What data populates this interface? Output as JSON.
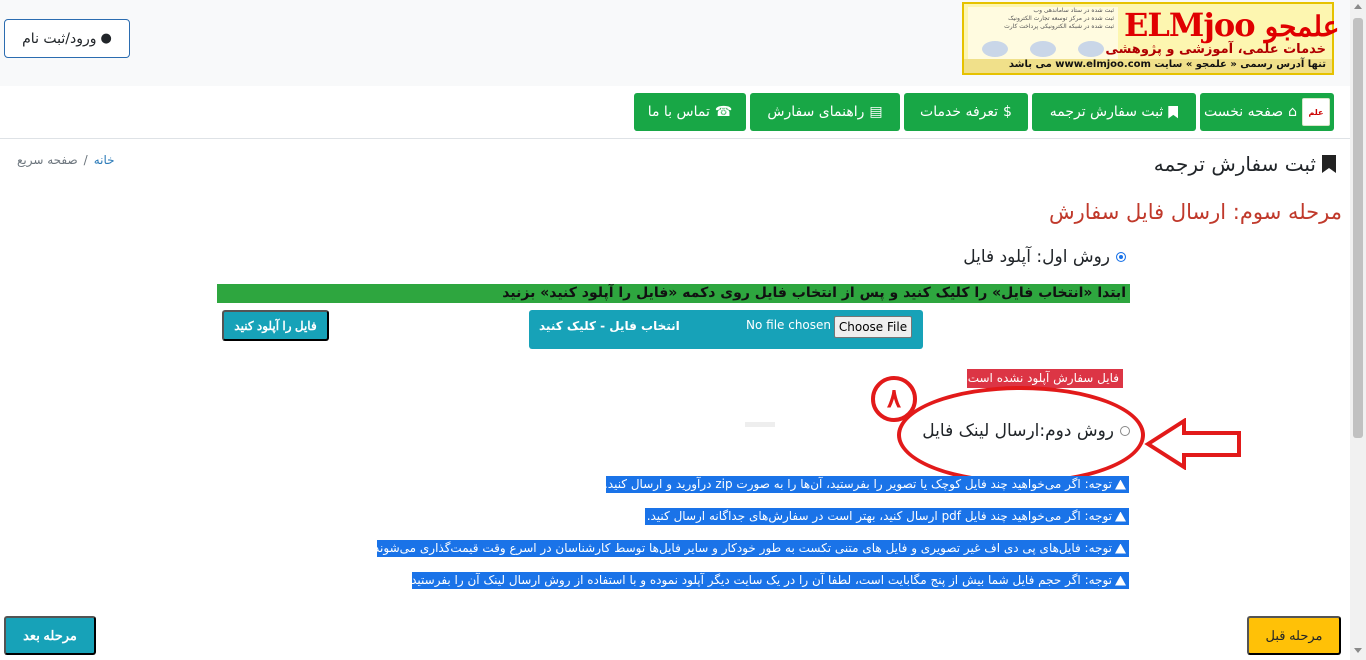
{
  "header": {
    "login_label": "ورود/ثبت نام",
    "login_icon": "user-icon",
    "logo": {
      "brand_latin": "ELMjoo",
      "brand_persian": "علمجو",
      "tagline": "خدمات علمی، آموزشی و پژوهشی",
      "url_line": "تنها آدرس رسمی « علمجو » سایت www.elmjoo.com می باشد",
      "trust_lines": [
        "ثبت شده در ستاد ساماندهی وب",
        "ثبت شده در مرکز توسعه تجارت الکترونیک",
        "ثبت شده در شبکه الکترونیکی پرداخت کارت"
      ]
    }
  },
  "nav": {
    "items": [
      {
        "label": "صفحه نخست",
        "icon": "home-icon"
      },
      {
        "label": "ثبت سفارش ترجمه",
        "icon": "bookmark-icon"
      },
      {
        "label": "تعرفه خدمات",
        "icon": "dollar-icon"
      },
      {
        "label": "راهنمای سفارش",
        "icon": "file-icon"
      },
      {
        "label": "تماس با ما",
        "icon": "phone-icon"
      }
    ]
  },
  "breadcrumb": {
    "home": "خانه",
    "separator": "/",
    "current": "صفحه سریع"
  },
  "page": {
    "title": "ثبت سفارش ترجمه",
    "step_title": "مرحله سوم: ارسال فایل سفارش"
  },
  "method1": {
    "label": "روش اول: آپلود فایل",
    "selected": true,
    "instruction": "ابتدا «انتخاب فایل» را کلیک کنید و پس از انتخاب فایل روی دکمه «فایل را آپلود کنید» بزنید",
    "file_label": "انتخاب فایل - کلیک کنید",
    "no_file_text": "No file chosen",
    "choose_button": "Choose File",
    "upload_button": "فایل را آپلود کنید",
    "error": "فایل سفارش آپلود نشده است."
  },
  "method2": {
    "label": "روش دوم:ارسال لینک فایل",
    "selected": false
  },
  "annotation": {
    "number": "۸",
    "color": "#e21a1a"
  },
  "notes": [
    "توجه: اگر می‌خواهید چند فایل کوچک یا تصویر را بفرستید، آن‌ها را به صورت zip درآورید و ارسال کنید.",
    "توجه: اگر می‌خواهید چند فایل pdf ارسال کنید، بهتر است در سفارش‌های جداگانه ارسال کنید.",
    "توجه: فایل‌های پی دی اف غیر تصویری و فایل های متنی تکست به طور خودکار و سایر فایل‌ها توسط کارشناسان در اسرع وقت قیمت‌گذاری می‌شوند.",
    "توجه: اگر حجم فایل شما بیش از پنج مگابایت است، لطفا آن را در یک سایت دیگر آپلود نموده و با استفاده از روش ارسال لینک آن را بفرستید."
  ],
  "footer": {
    "next_label": "مرحله بعد",
    "prev_label": "مرحله قبل"
  },
  "colors": {
    "nav_green": "#18a746",
    "teal": "#17a2b8",
    "note_blue": "#1a73e8",
    "error_red": "#dc3545",
    "step_red": "#c0392b",
    "prev_yellow": "#ffc107"
  }
}
